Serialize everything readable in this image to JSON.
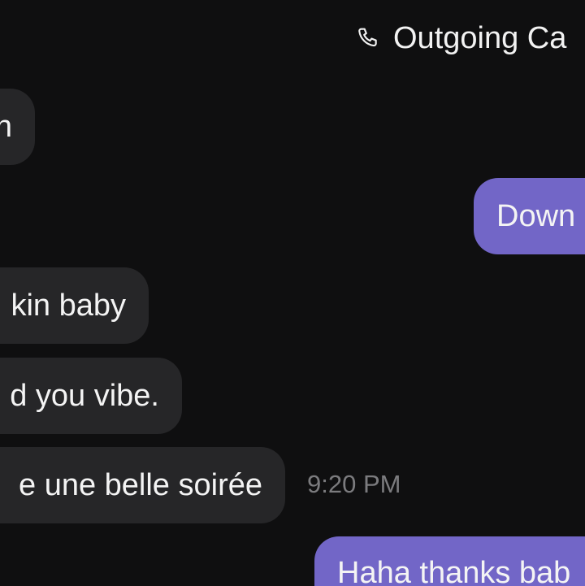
{
  "call_status": {
    "icon": "phone-icon",
    "label": "Outgoing Ca"
  },
  "messages": [
    {
      "direction": "incoming",
      "text": "n"
    },
    {
      "direction": "outgoing",
      "text": "Down"
    },
    {
      "direction": "incoming",
      "text": "kin baby"
    },
    {
      "direction": "incoming",
      "text": "d you vibe."
    },
    {
      "direction": "incoming",
      "text": "e une belle soirée"
    },
    {
      "direction": "outgoing",
      "text": "Haha thanks bab"
    }
  ],
  "timestamp": "9:20 PM",
  "colors": {
    "background": "#0f0f10",
    "incoming_bubble": "#262628",
    "outgoing_bubble": "#7266c7",
    "timestamp": "#7b7b7e"
  }
}
